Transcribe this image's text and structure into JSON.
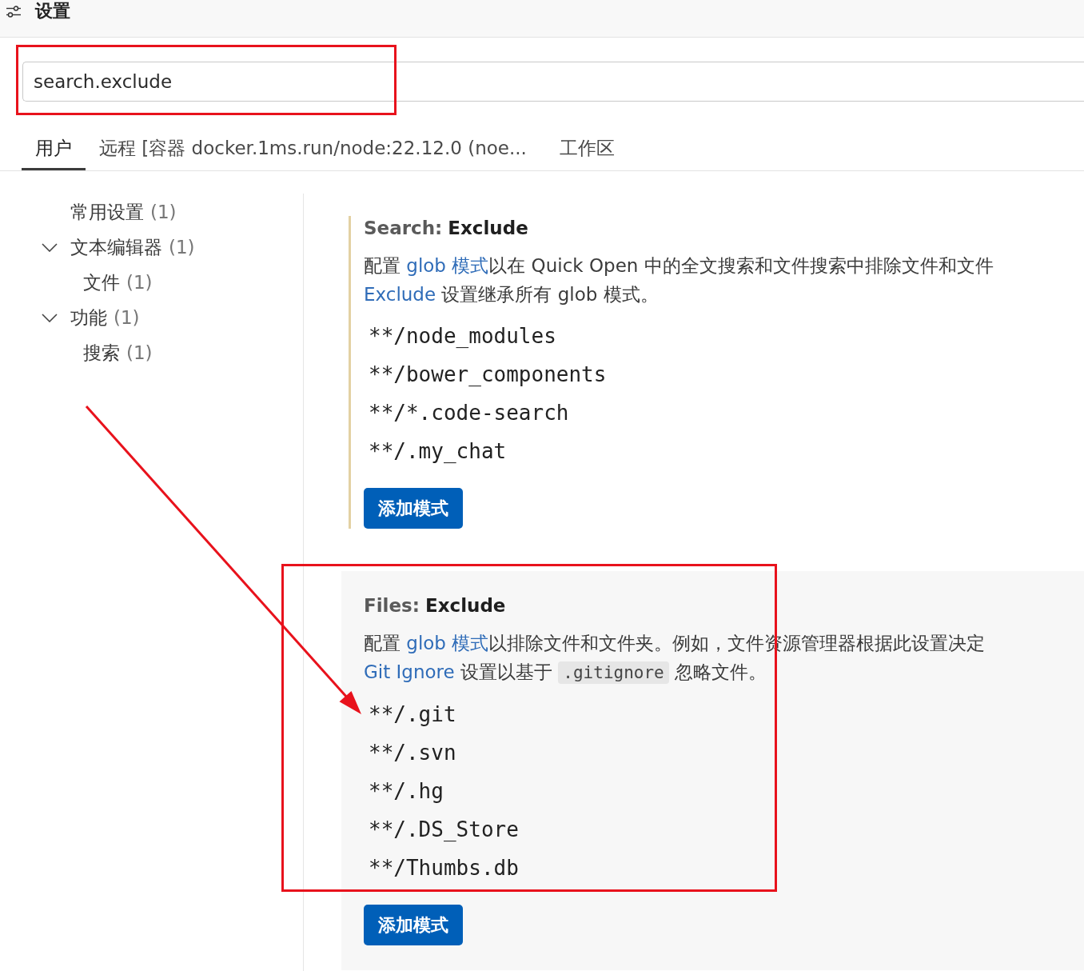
{
  "header": {
    "title": "设置"
  },
  "search": {
    "value": "search.exclude",
    "highlighted": true
  },
  "tabs": [
    {
      "label": "用户",
      "selected": true
    },
    {
      "label": "远程 [容器 docker.1ms.run/node:22.12.0 (noe...",
      "selected": false
    },
    {
      "label": "工作区",
      "selected": false
    }
  ],
  "toc": [
    {
      "kind": "leaf",
      "label": "常用设置",
      "count": "(1)"
    },
    {
      "kind": "group",
      "label": "文本编辑器",
      "count": "(1)",
      "expanded": true,
      "children": [
        {
          "kind": "leaf",
          "label": "文件",
          "count": "(1)"
        }
      ]
    },
    {
      "kind": "group",
      "label": "功能",
      "count": "(1)",
      "expanded": true,
      "children": [
        {
          "kind": "leaf",
          "label": "搜索",
          "count": "(1)"
        }
      ]
    }
  ],
  "settings": [
    {
      "category": "Search:",
      "name": "Exclude",
      "modified": true,
      "hovered": false,
      "highlighted": false,
      "description": [
        [
          {
            "kind": "text",
            "text": "配置 "
          },
          {
            "kind": "link",
            "text": "glob 模式"
          },
          {
            "kind": "text",
            "text": "以在 Quick Open 中的全文搜索和文件搜索中排除文件和文件"
          }
        ],
        [
          {
            "kind": "link",
            "text": "Exclude"
          },
          {
            "kind": "text",
            "text": " 设置继承所有 glob 模式。"
          }
        ]
      ],
      "patterns": [
        "**/node_modules",
        "**/bower_components",
        "**/*.code-search",
        "**/.my_chat"
      ],
      "add_button": "添加模式"
    },
    {
      "category": "Files:",
      "name": "Exclude",
      "modified": false,
      "hovered": true,
      "highlighted": true,
      "description": [
        [
          {
            "kind": "text",
            "text": "配置 "
          },
          {
            "kind": "link",
            "text": "glob 模式"
          },
          {
            "kind": "text",
            "text": "以排除文件和文件夹。例如，文件资源管理器根据此设置决定"
          }
        ],
        [
          {
            "kind": "link",
            "text": "Git Ignore"
          },
          {
            "kind": "text",
            "text": " 设置以基于 "
          },
          {
            "kind": "code",
            "text": ".gitignore"
          },
          {
            "kind": "text",
            "text": " 忽略文件。"
          }
        ]
      ],
      "patterns": [
        "**/.git",
        "**/.svn",
        "**/.hg",
        "**/.DS_Store",
        "**/Thumbs.db"
      ],
      "add_button": "添加模式"
    }
  ],
  "annotation_arrow": true
}
